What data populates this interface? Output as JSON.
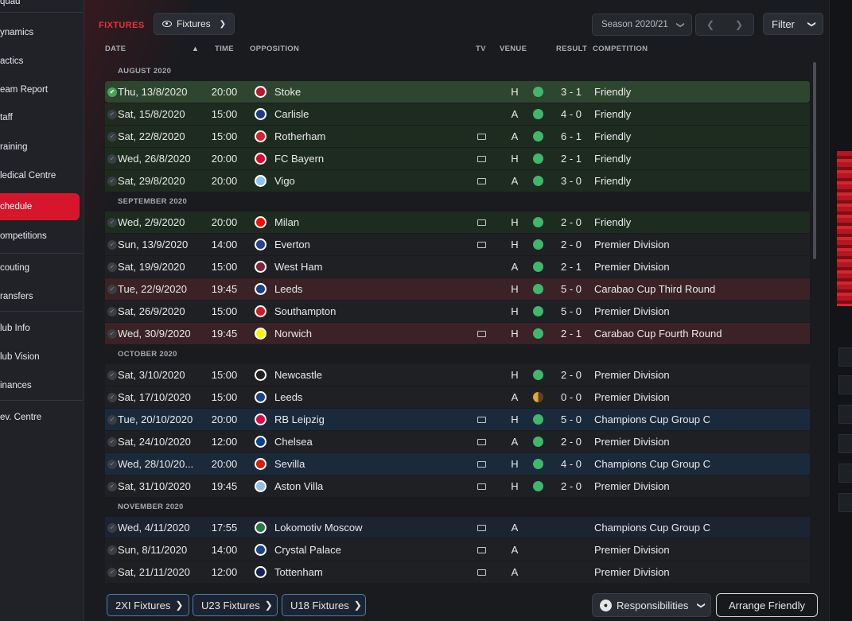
{
  "sidebar": {
    "items": [
      {
        "label": "quad"
      },
      {
        "label": "ynamics"
      },
      {
        "label": "actics"
      },
      {
        "label": "eam Report"
      },
      {
        "label": "taff"
      },
      {
        "label": "raining"
      },
      {
        "label": "ledical Centre"
      },
      {
        "label": "chedule"
      },
      {
        "label": "ompetitions"
      },
      {
        "label": "couting"
      },
      {
        "label": "ransfers"
      },
      {
        "label": "lub Info"
      },
      {
        "label": "lub Vision"
      },
      {
        "label": "inances"
      },
      {
        "label": "ev. Centre"
      }
    ],
    "active_item": "chedule",
    "accent_color": "#d8162b"
  },
  "header": {
    "title": "FIXTURES",
    "view_dropdown": "Fixtures",
    "season_dropdown": "Season 2020/21",
    "filter_label": "Filter"
  },
  "columns": {
    "date": "DATE",
    "time": "TIME",
    "opposition": "OPPOSITION",
    "tv": "TV",
    "venue": "VENUE",
    "result": "RESULT",
    "competition": "COMPETITION"
  },
  "months": [
    {
      "label": "AUGUST 2020"
    },
    {
      "label": "SEPTEMBER 2020"
    },
    {
      "label": "OCTOBER 2020"
    },
    {
      "label": "NOVEMBER 2020"
    }
  ],
  "fixtures": [
    {
      "date": "Thu, 13/8/2020",
      "time": "20:00",
      "opposition": "Stoke",
      "tv": false,
      "venue": "H",
      "result": "3 - 1",
      "outcome": "win",
      "competition": "Friendly",
      "type": "friendly",
      "badge_color": "#c8102e",
      "selected": true
    },
    {
      "date": "Sat, 15/8/2020",
      "time": "15:00",
      "opposition": "Carlisle",
      "tv": false,
      "venue": "A",
      "result": "4 - 0",
      "outcome": "win",
      "competition": "Friendly",
      "type": "friendly",
      "badge_color": "#1f3b8a"
    },
    {
      "date": "Sat, 22/8/2020",
      "time": "15:00",
      "opposition": "Rotherham",
      "tv": true,
      "venue": "A",
      "result": "6 - 1",
      "outcome": "win",
      "competition": "Friendly",
      "type": "friendly",
      "badge_color": "#d3232f"
    },
    {
      "date": "Wed, 26/8/2020",
      "time": "20:00",
      "opposition": "FC Bayern",
      "tv": true,
      "venue": "H",
      "result": "2 - 1",
      "outcome": "win",
      "competition": "Friendly",
      "type": "friendly",
      "badge_color": "#dc052d"
    },
    {
      "date": "Sat, 29/8/2020",
      "time": "20:00",
      "opposition": "Vigo",
      "tv": true,
      "venue": "A",
      "result": "3 - 0",
      "outcome": "win",
      "competition": "Friendly",
      "type": "friendly",
      "badge_color": "#8ac3ee"
    },
    {
      "date": "Wed, 2/9/2020",
      "time": "20:00",
      "opposition": "Milan",
      "tv": true,
      "venue": "H",
      "result": "2 - 0",
      "outcome": "win",
      "competition": "Friendly",
      "type": "friendly",
      "badge_color": "#fb090b"
    },
    {
      "date": "Sun, 13/9/2020",
      "time": "14:00",
      "opposition": "Everton",
      "tv": true,
      "venue": "H",
      "result": "2 - 0",
      "outcome": "win",
      "competition": "Premier Division",
      "type": "league",
      "badge_color": "#274488"
    },
    {
      "date": "Sat, 19/9/2020",
      "time": "15:00",
      "opposition": "West Ham",
      "tv": false,
      "venue": "A",
      "result": "2 - 1",
      "outcome": "win",
      "competition": "Premier Division",
      "type": "league",
      "badge_color": "#7a263a"
    },
    {
      "date": "Tue, 22/9/2020",
      "time": "19:45",
      "opposition": "Leeds",
      "tv": false,
      "venue": "H",
      "result": "5 - 0",
      "outcome": "win",
      "competition": "Carabao Cup Third Round",
      "type": "cup",
      "badge_color": "#1d428a"
    },
    {
      "date": "Sat, 26/9/2020",
      "time": "15:00",
      "opposition": "Southampton",
      "tv": false,
      "venue": "H",
      "result": "5 - 0",
      "outcome": "win",
      "competition": "Premier Division",
      "type": "league",
      "badge_color": "#d71920"
    },
    {
      "date": "Wed, 30/9/2020",
      "time": "19:45",
      "opposition": "Norwich",
      "tv": true,
      "venue": "H",
      "result": "2 - 1",
      "outcome": "win",
      "competition": "Carabao Cup Fourth Round",
      "type": "cup",
      "badge_color": "#fff200"
    },
    {
      "date": "Sat, 3/10/2020",
      "time": "15:00",
      "opposition": "Newcastle",
      "tv": false,
      "venue": "H",
      "result": "2 - 0",
      "outcome": "win",
      "competition": "Premier Division",
      "type": "league",
      "badge_color": "#241f20"
    },
    {
      "date": "Sat, 17/10/2020",
      "time": "15:00",
      "opposition": "Leeds",
      "tv": false,
      "venue": "A",
      "result": "0 - 0",
      "outcome": "draw",
      "competition": "Premier Division",
      "type": "league",
      "badge_color": "#1d428a"
    },
    {
      "date": "Tue, 20/10/2020",
      "time": "20:00",
      "opposition": "RB Leipzig",
      "tv": true,
      "venue": "H",
      "result": "5 - 0",
      "outcome": "win",
      "competition": "Champions Cup Group C",
      "type": "euro",
      "badge_color": "#dd0741"
    },
    {
      "date": "Sat, 24/10/2020",
      "time": "12:00",
      "opposition": "Chelsea",
      "tv": true,
      "venue": "A",
      "result": "2 - 0",
      "outcome": "win",
      "competition": "Premier Division",
      "type": "league",
      "badge_color": "#034694"
    },
    {
      "date": "Wed, 28/10/20...",
      "time": "20:00",
      "opposition": "Sevilla",
      "tv": true,
      "venue": "H",
      "result": "4 - 0",
      "outcome": "win",
      "competition": "Champions Cup Group C",
      "type": "euro",
      "badge_color": "#d81e05"
    },
    {
      "date": "Sat, 31/10/2020",
      "time": "19:45",
      "opposition": "Aston Villa",
      "tv": true,
      "venue": "H",
      "result": "2 - 0",
      "outcome": "win",
      "competition": "Premier Division",
      "type": "league",
      "badge_color": "#95bfe5"
    },
    {
      "date": "Wed, 4/11/2020",
      "time": "17:55",
      "opposition": "Lokomotiv Moscow",
      "tv": true,
      "venue": "A",
      "result": "",
      "outcome": "none",
      "competition": "Champions Cup Group C",
      "type": "euro",
      "badge_color": "#2a7a3b"
    },
    {
      "date": "Sun, 8/11/2020",
      "time": "14:00",
      "opposition": "Crystal Palace",
      "tv": true,
      "venue": "A",
      "result": "",
      "outcome": "none",
      "competition": "Premier Division",
      "type": "league",
      "badge_color": "#1b458f"
    },
    {
      "date": "Sat, 21/11/2020",
      "time": "12:00",
      "opposition": "Tottenham",
      "tv": true,
      "venue": "A",
      "result": "",
      "outcome": "none",
      "competition": "Premier Division",
      "type": "league",
      "badge_color": "#132257"
    }
  ],
  "outcome_colors": {
    "win": "#3fb86a",
    "draw": "#e0a93a"
  },
  "bottom": {
    "tabs": [
      "2XI Fixtures",
      "U23 Fixtures",
      "U18 Fixtures"
    ],
    "responsibilities": "Responsibilities",
    "arrange_friendly": "Arrange Friendly"
  }
}
